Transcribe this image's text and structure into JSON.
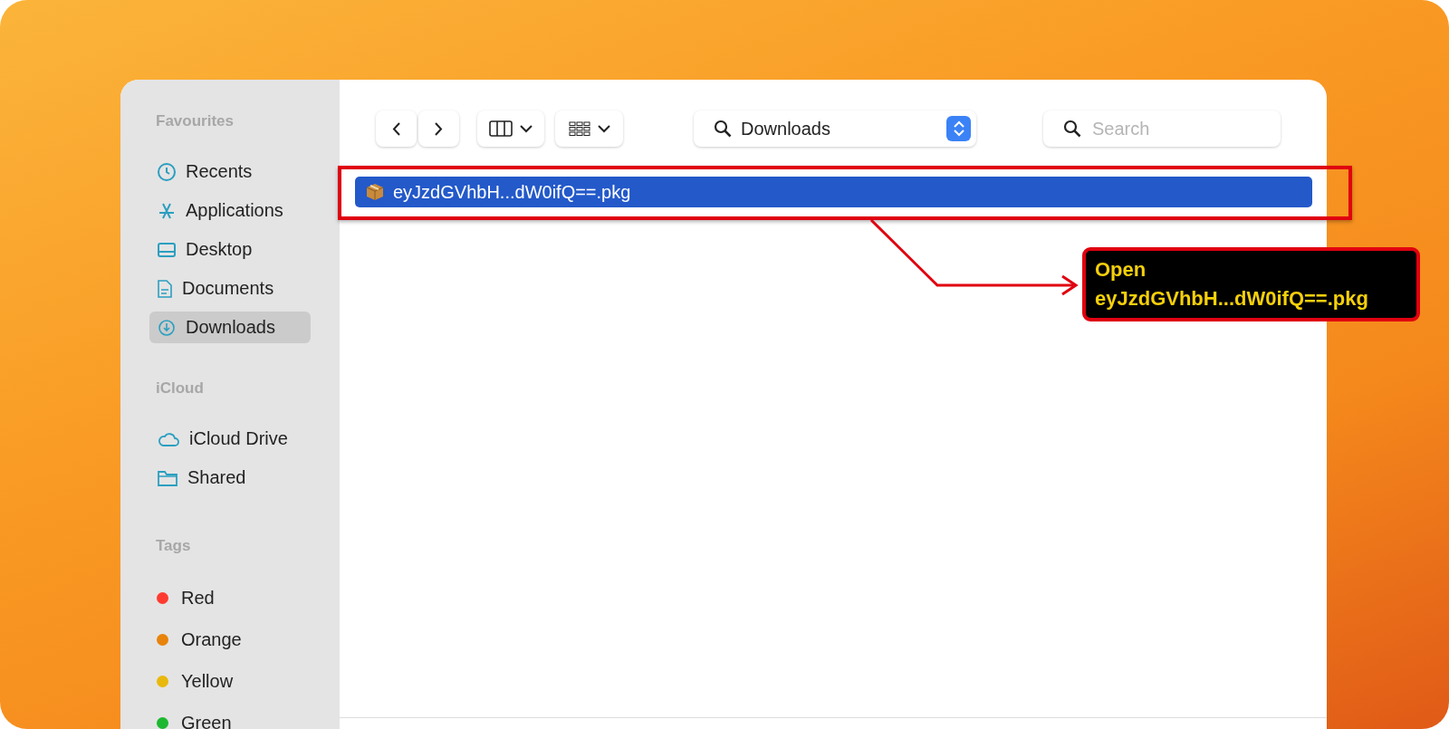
{
  "sidebar": {
    "sections": [
      {
        "title": "Favourites",
        "items": [
          {
            "kind": "link",
            "label": "Recents",
            "selected": false
          },
          {
            "kind": "link",
            "label": "Applications",
            "selected": false
          },
          {
            "kind": "link",
            "label": "Desktop",
            "selected": false
          },
          {
            "kind": "link",
            "label": "Documents",
            "selected": false
          },
          {
            "kind": "link",
            "label": "Downloads",
            "selected": true
          }
        ]
      },
      {
        "title": "iCloud",
        "items": [
          {
            "kind": "link",
            "label": "iCloud Drive",
            "selected": false
          },
          {
            "kind": "link",
            "label": "Shared",
            "selected": false
          }
        ]
      },
      {
        "title": "Tags",
        "items": [
          {
            "kind": "tag",
            "label": "Red",
            "color": "#ff3b30"
          },
          {
            "kind": "tag",
            "label": "Orange",
            "color": "#e8830c"
          },
          {
            "kind": "tag",
            "label": "Yellow",
            "color": "#e8b90c"
          },
          {
            "kind": "tag",
            "label": "Green",
            "color": "#1db830"
          }
        ]
      }
    ]
  },
  "toolbar": {
    "location": "Downloads",
    "search": {
      "placeholder": "Search"
    }
  },
  "files": [
    {
      "name": "eyJzdGVhbH...dW0ifQ==.pkg",
      "selected": true
    }
  ],
  "callout": {
    "lines": [
      "Open",
      "eyJzdGVhbH...dW0ifQ==.pkg"
    ]
  }
}
